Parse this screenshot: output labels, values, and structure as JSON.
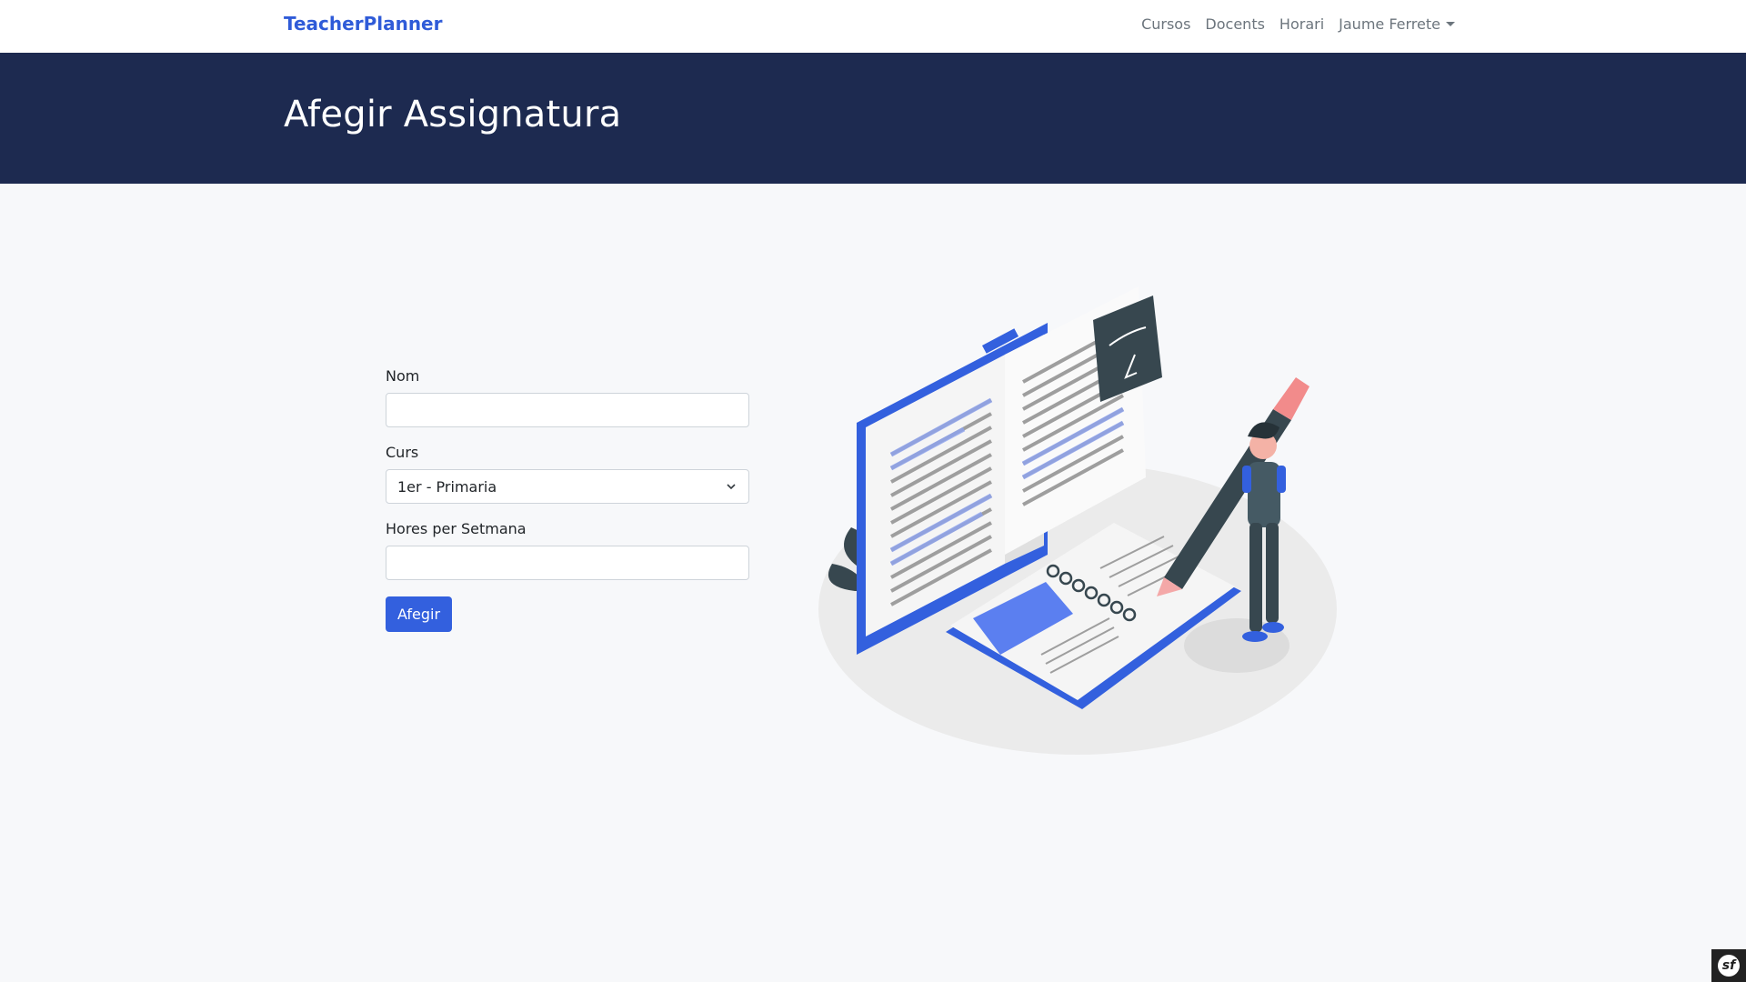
{
  "nav": {
    "brand": "TeacherPlanner",
    "links": [
      "Cursos",
      "Docents",
      "Horari"
    ],
    "user": "Jaume Ferrete"
  },
  "hero": {
    "title": "Afegir Assignatura"
  },
  "form": {
    "nom_label": "Nom",
    "nom_value": "",
    "curs_label": "Curs",
    "curs_selected": "1er - Primaria",
    "hores_label": "Hores per Setmana",
    "hores_value": "",
    "submit_label": "Afegir"
  },
  "illustration": {
    "icon": "study-illustration"
  },
  "debug_badge": {
    "icon": "symfony-toolbar-icon",
    "glyph": "sf"
  },
  "colors": {
    "brand": "#2f5bd8",
    "hero_bg": "#1d2a50",
    "button": "#3360de"
  }
}
